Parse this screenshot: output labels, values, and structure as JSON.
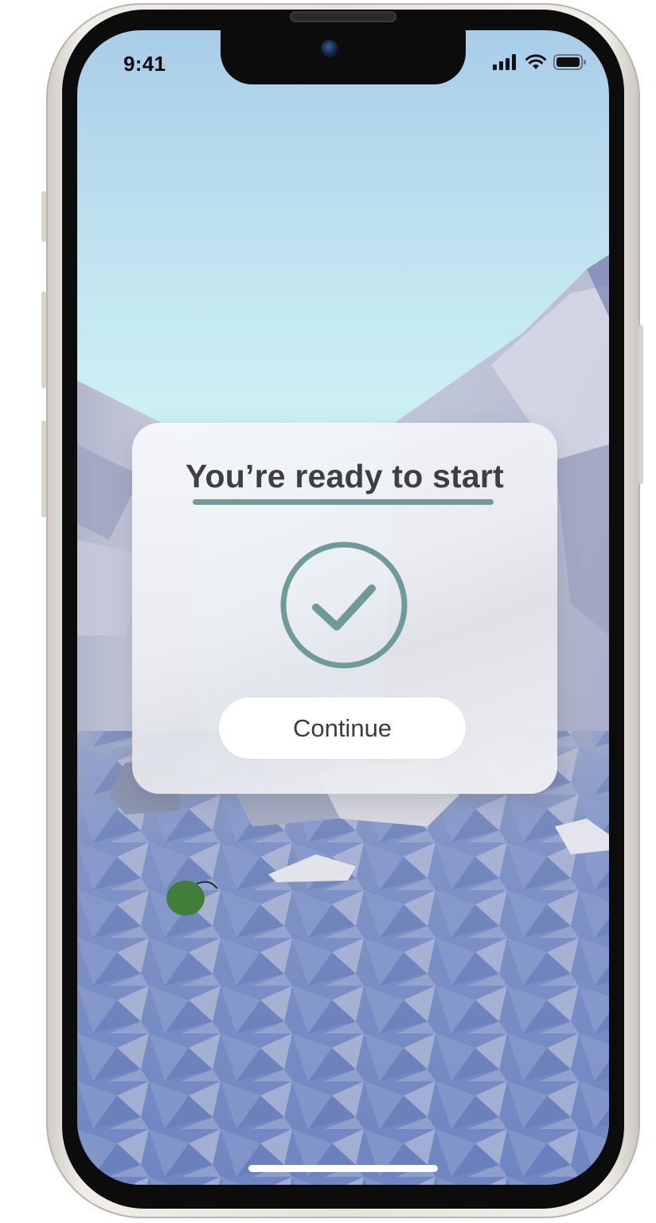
{
  "status_bar": {
    "time": "9:41",
    "icons": [
      "cellular-signal-icon",
      "wifi-icon",
      "battery-icon"
    ]
  },
  "dialog": {
    "title": "You’re ready to start",
    "icon": "checkmark-circle-icon",
    "continue_label": "Continue"
  },
  "colors": {
    "accent": "#6f9a9a",
    "title_text": "#3f3f3f",
    "sky_top": "#a9cde8",
    "sky_bottom": "#d6f3f2",
    "water": "#7f95c8"
  }
}
